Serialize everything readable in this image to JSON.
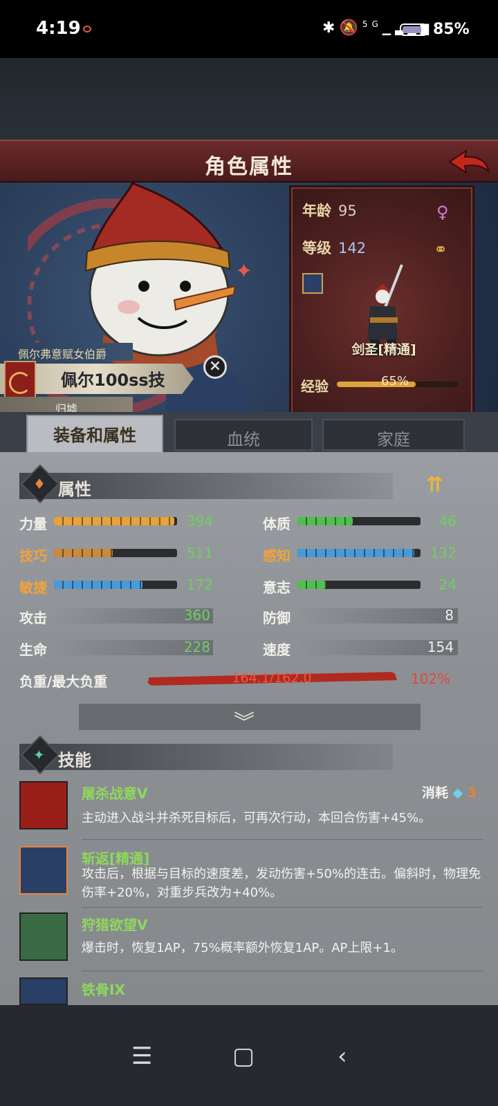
{
  "status_bar": {
    "time": "4:19",
    "network": "5G",
    "battery_pct": "85%",
    "battery_level": 0.85
  },
  "header": {
    "title": "角色属性"
  },
  "character": {
    "title": "佩尔弗意赋女伯爵",
    "name": "佩尔100ss技",
    "origin": "归墟",
    "age_label": "年龄",
    "age": "95",
    "level_label": "等级",
    "level": "142",
    "class_name": "剑圣[精通]",
    "exp_label": "经验",
    "exp_pct": "65%",
    "exp_level": 0.65
  },
  "tabs": [
    {
      "label": "装备和属性",
      "active": true
    },
    {
      "label": "血统",
      "active": false
    },
    {
      "label": "家庭",
      "active": false
    }
  ],
  "attributes": {
    "section_title": "属性",
    "bar_stats": [
      {
        "label": "力量",
        "value": "394",
        "fill": 0.98,
        "color": "#e8a23c",
        "label_color": "white"
      },
      {
        "label": "体质",
        "value": "46",
        "fill": 0.45,
        "color": "#4fbf4f",
        "label_color": "white"
      },
      {
        "label": "技巧",
        "value": "511",
        "fill": 0.48,
        "color": "#c88a3c",
        "label_color": "orange"
      },
      {
        "label": "感知",
        "value": "132",
        "fill": 0.95,
        "color": "#4a9ad8",
        "label_color": "orange"
      },
      {
        "label": "敏捷",
        "value": "172",
        "fill": 0.72,
        "color": "#4a9ad8",
        "label_color": "orange"
      },
      {
        "label": "意志",
        "value": "24",
        "fill": 0.23,
        "color": "#4fbf4f",
        "label_color": "white"
      }
    ],
    "plain_stats": [
      {
        "label": "攻击",
        "value": "360"
      },
      {
        "label": "防御",
        "value": "8"
      },
      {
        "label": "生命",
        "value": "228"
      },
      {
        "label": "速度",
        "value": "154"
      }
    ],
    "weight": {
      "label": "负重/最大负重",
      "value": "164.1/162.0",
      "pct": "102%"
    }
  },
  "skills": {
    "section_title": "技能",
    "cost_label": "消耗",
    "cost_value": "3",
    "items": [
      {
        "name": "屠杀战意V",
        "desc": "主动进入战斗并杀死目标后，可再次行动，本回合伤害+45%。"
      },
      {
        "name": "斩返[精通]",
        "desc": "攻击后，根据与目标的速度差，发动伤害+50%的连击。偏斜时，物理免伤率+20%，对重步兵改为+40%。"
      },
      {
        "name": "狩猎欲望V",
        "desc": "爆击时，恢复1AP，75%概率额外恢复1AP。AP上限+1。"
      },
      {
        "name": "铁骨IX",
        "desc": ""
      }
    ]
  }
}
